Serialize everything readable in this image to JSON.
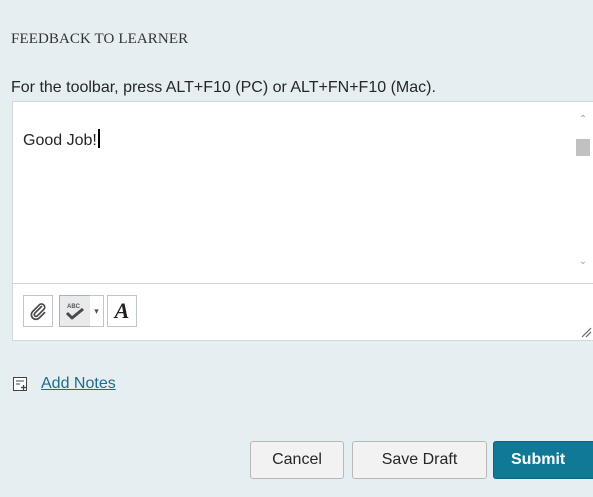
{
  "section": {
    "heading": "FEEDBACK TO LEARNER",
    "toolbar_hint": "For the toolbar, press ALT+F10 (PC) or ALT+FN+F10 (Mac)."
  },
  "editor": {
    "content": "Good Job!",
    "scroll_up_glyph": "⌃",
    "scroll_down_glyph": "⌄",
    "toolbar": {
      "icons": [
        "paperclip-icon",
        "spellcheck-icon",
        "chevron-down-icon",
        "font-style-icon",
        "resize-grip-icon"
      ],
      "spell_dropdown_glyph": "▾",
      "font_glyph": "A"
    }
  },
  "notes": {
    "link_label": "Add Notes",
    "icon": "add-note-icon"
  },
  "actions": {
    "cancel_label": "Cancel",
    "save_draft_label": "Save Draft",
    "submit_label": "Submit"
  },
  "colors": {
    "background": "#e5eef1",
    "link": "#1f6b8a",
    "submit": "#0f7996"
  }
}
